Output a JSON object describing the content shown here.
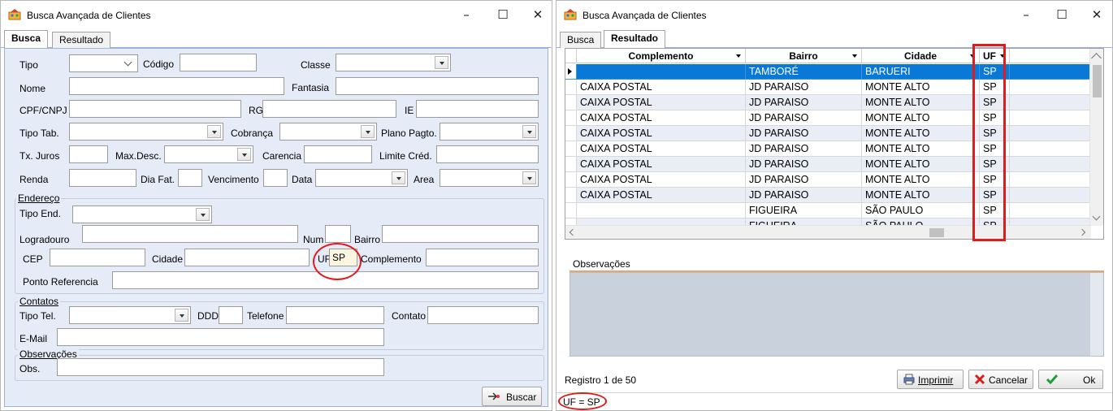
{
  "colors": {
    "accent": "#0a78d7",
    "panel": "#e5ebf7",
    "highlight": "#e01b1b"
  },
  "left_window": {
    "title": "Busca Avançada de Clientes",
    "controls": {
      "minimize": "–",
      "maximize": "☐",
      "close": "✕"
    },
    "tabs": [
      "Busca",
      "Resultado"
    ],
    "active_tab": "Busca",
    "form": {
      "tipo_label": "Tipo",
      "codigo_label": "Código",
      "classe_label": "Classe",
      "nome_label": "Nome",
      "fantasia_label": "Fantasia",
      "cpf_label": "CPF/CNPJ",
      "rg_label": "RG",
      "ie_label": "IE",
      "tipo_tab_label": "Tipo Tab.",
      "cobranca_label": "Cobrança",
      "plano_label": "Plano Pagto.",
      "tx_juros_label": "Tx. Juros",
      "max_desc_label": "Max.Desc.",
      "carencia_label": "Carencia",
      "limite_label": "Limite Créd.",
      "renda_label": "Renda",
      "dia_fat_label": "Dia Fat.",
      "vencimento_label": "Vencimento",
      "data_label": "Data",
      "area_label": "Area"
    },
    "endereco": {
      "group_title": "Endereço",
      "tipo_end_label": "Tipo End.",
      "logradouro_label": "Logradouro",
      "num_label": "Num",
      "bairro_label": "Bairro",
      "cep_label": "CEP",
      "cidade_label": "Cidade",
      "uf_label": "UF",
      "uf_value": "SP",
      "complemento_label": "Complemento",
      "ponto_ref_label": "Ponto Referencia"
    },
    "contatos": {
      "group_title": "Contatos",
      "tipo_tel_label": "Tipo Tel.",
      "ddd_label": "DDD",
      "telefone_label": "Telefone",
      "contato_label": "Contato",
      "email_label": "E-Mail"
    },
    "observacoes": {
      "group_title": "Observações",
      "obs_label": "Obs."
    },
    "buscar_button": "Buscar"
  },
  "right_window": {
    "title": "Busca Avançada de Clientes",
    "controls": {
      "minimize": "–",
      "maximize": "☐",
      "close": "✕"
    },
    "tabs": [
      "Busca",
      "Resultado"
    ],
    "active_tab": "Resultado",
    "grid": {
      "columns": [
        "Complemento",
        "Bairro",
        "Cidade",
        "UF"
      ],
      "rows": [
        {
          "complemento": "",
          "bairro": "TAMBORÉ",
          "cidade": "BARUERI",
          "uf": "SP",
          "selected": true
        },
        {
          "complemento": "CAIXA POSTAL",
          "bairro": "JD PARAISO",
          "cidade": "MONTE ALTO",
          "uf": "SP"
        },
        {
          "complemento": "CAIXA POSTAL",
          "bairro": "JD PARAISO",
          "cidade": "MONTE ALTO",
          "uf": "SP"
        },
        {
          "complemento": "CAIXA POSTAL",
          "bairro": "JD PARAISO",
          "cidade": "MONTE ALTO",
          "uf": "SP"
        },
        {
          "complemento": "CAIXA POSTAL",
          "bairro": "JD PARAISO",
          "cidade": "MONTE ALTO",
          "uf": "SP"
        },
        {
          "complemento": "CAIXA POSTAL",
          "bairro": "JD PARAISO",
          "cidade": "MONTE ALTO",
          "uf": "SP"
        },
        {
          "complemento": "CAIXA POSTAL",
          "bairro": "JD PARAISO",
          "cidade": "MONTE ALTO",
          "uf": "SP"
        },
        {
          "complemento": "CAIXA POSTAL",
          "bairro": "JD PARAISO",
          "cidade": "MONTE ALTO",
          "uf": "SP"
        },
        {
          "complemento": "CAIXA POSTAL",
          "bairro": "JD PARAISO",
          "cidade": "MONTE ALTO",
          "uf": "SP"
        },
        {
          "complemento": "",
          "bairro": "FIGUEIRA",
          "cidade": "SÃO PAULO",
          "uf": "SP"
        },
        {
          "complemento": "",
          "bairro": "FIGUEIRA",
          "cidade": "SÃO PAULO",
          "uf": "SP"
        }
      ]
    },
    "observacoes_label": "Observações",
    "registro_text": "Registro 1 de 50",
    "imprimir_button": "Imprimir",
    "cancelar_button": "Cancelar",
    "ok_button": "Ok",
    "filter_text": "UF = SP"
  }
}
